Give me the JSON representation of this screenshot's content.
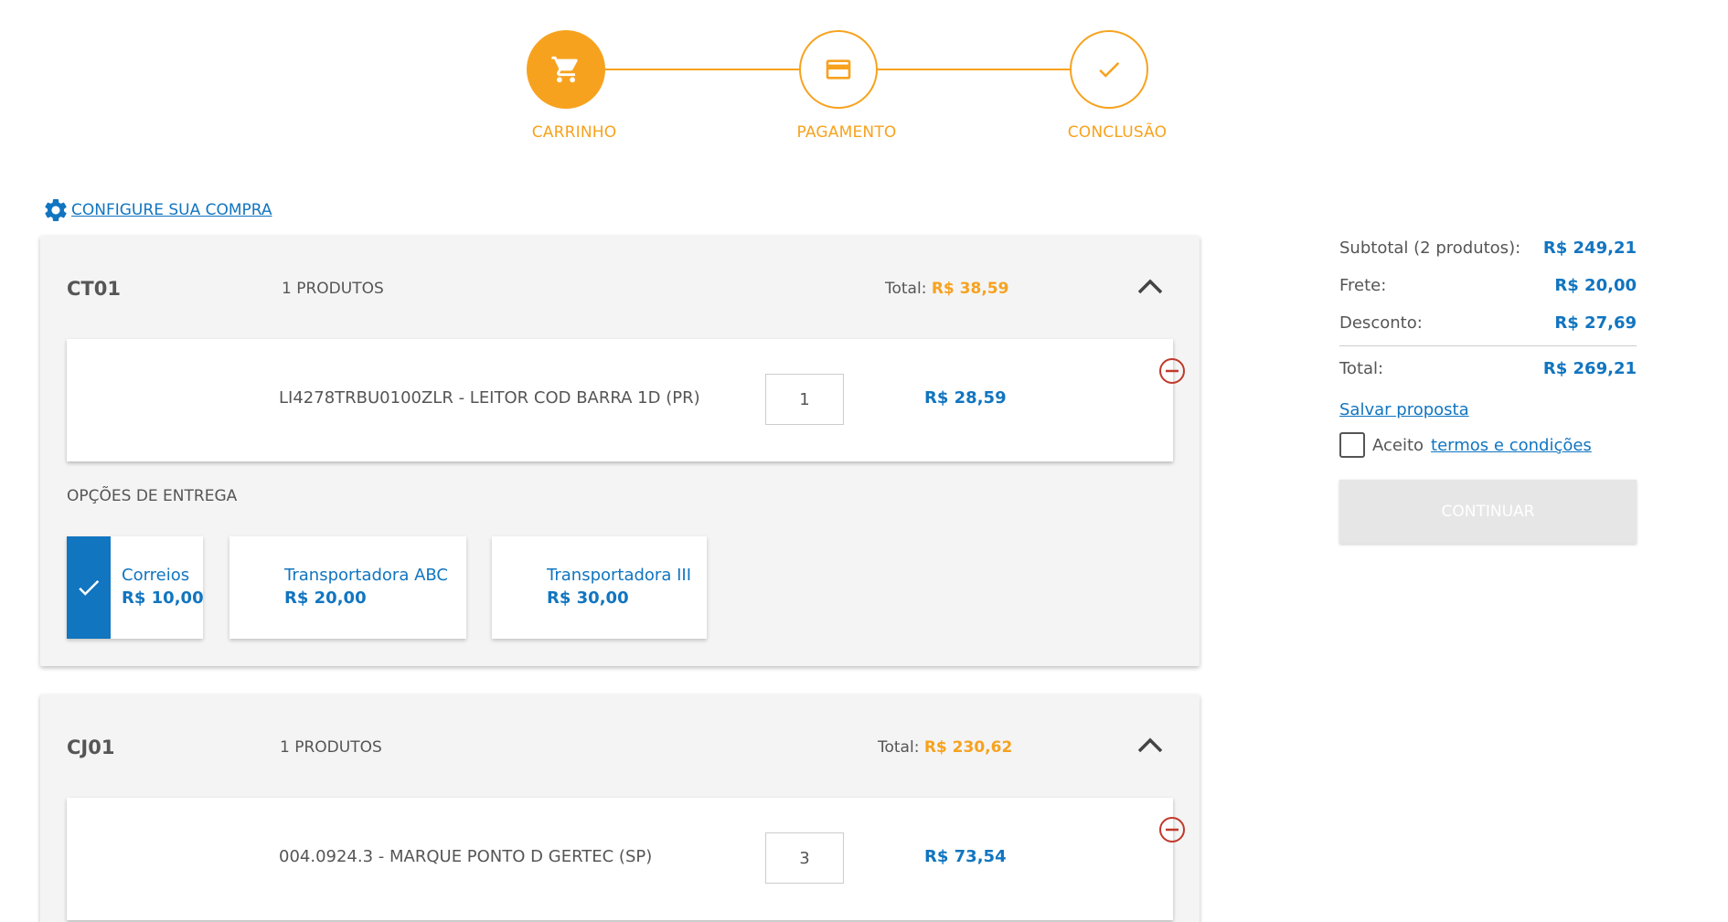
{
  "stepper": {
    "steps": [
      {
        "label": "CARRINHO",
        "icon": "cart-icon",
        "active": true
      },
      {
        "label": "PAGAMENTO",
        "icon": "credit-card-icon",
        "active": false
      },
      {
        "label": "CONCLUSÃO",
        "icon": "check-icon",
        "active": false
      }
    ],
    "color": "#f7a21e"
  },
  "configure": {
    "label": "CONFIGURE SUA COMPRA",
    "icon": "gear-icon"
  },
  "groups": [
    {
      "code": "CT01",
      "count": "1 PRODUTOS",
      "total_label": "Total:",
      "total_value": "R$ 38,59",
      "product": {
        "name": "LI4278TRBU0100ZLR - LEITOR COD BARRA 1D (PR)",
        "qty": "1",
        "price": "R$ 28,59"
      },
      "delivery_title": "OPÇÕES DE ENTREGA",
      "delivery_options": [
        {
          "name": "Correios",
          "price": "R$ 10,00",
          "selected": true
        },
        {
          "name": "Transportadora ABC",
          "price": "R$ 20,00",
          "selected": false
        },
        {
          "name": "Transportadora III",
          "price": "R$ 30,00",
          "selected": false
        }
      ]
    },
    {
      "code": "CJ01",
      "count": "1 PRODUTOS",
      "total_label": "Total:",
      "total_value": "R$ 230,62",
      "product": {
        "name": "004.0924.3 - MARQUE PONTO D GERTEC (SP)",
        "qty": "3",
        "price": "R$ 73,54"
      }
    }
  ],
  "summary": {
    "subtotal_label": "Subtotal (2 produtos):",
    "subtotal_value": "R$ 249,21",
    "frete_label": "Frete:",
    "frete_value": "R$ 20,00",
    "desconto_label": "Desconto:",
    "desconto_value": "R$ 27,69",
    "total_label": "Total:",
    "total_value": "R$ 269,21",
    "save_label": "Salvar proposta",
    "terms_prefix": "Aceito",
    "terms_link": "termos e condições",
    "continue_label": "CONTINUAR"
  },
  "colors": {
    "accent": "#f7a21e",
    "primary": "#1175c0",
    "danger": "#c0392b"
  }
}
